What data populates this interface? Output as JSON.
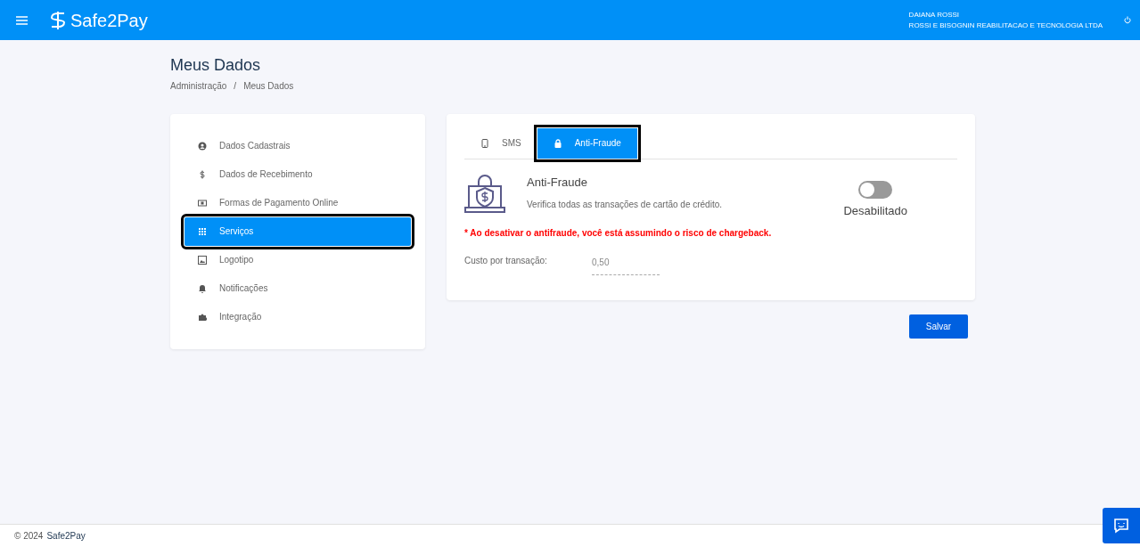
{
  "header": {
    "brand": "Safe2Pay",
    "user_name": "DAIANA ROSSI",
    "company": "ROSSI E BISOGNIN REABILITACAO E TECNOLOGIA LTDA"
  },
  "page": {
    "title": "Meus Dados",
    "breadcrumb": [
      "Administração",
      "Meus Dados"
    ],
    "breadcrumb_separator": "/"
  },
  "sidebar": {
    "items": [
      {
        "label": "Dados Cadastrais",
        "selected": false
      },
      {
        "label": "Dados de Recebimento",
        "selected": false
      },
      {
        "label": "Formas de Pagamento Online",
        "selected": false
      },
      {
        "label": "Serviços",
        "selected": true
      },
      {
        "label": "Logotipo",
        "selected": false
      },
      {
        "label": "Notificações",
        "selected": false
      },
      {
        "label": "Integração",
        "selected": false
      }
    ]
  },
  "tabs": [
    {
      "label": "SMS",
      "selected": false
    },
    {
      "label": "Anti-Fraude",
      "selected": true
    }
  ],
  "service": {
    "title": "Anti-Fraude",
    "description": "Verifica todas as transações de cartão de crédito.",
    "on": false,
    "status": "Desabilitado",
    "warning": "* Ao desativar o antifraude, você está assumindo o risco de chargeback.",
    "cost_label": "Custo por transação:",
    "cost_value": "0,50"
  },
  "save_button": "Salvar",
  "footer": {
    "copyright": "© 2024",
    "brand": "Safe2Pay"
  }
}
